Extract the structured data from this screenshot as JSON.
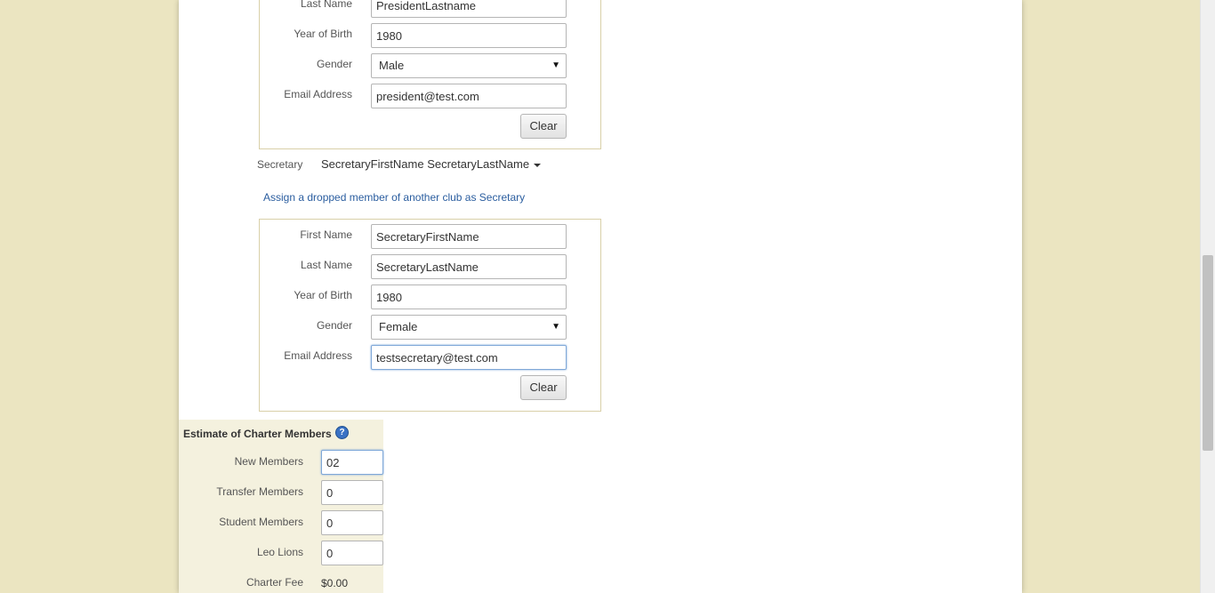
{
  "president": {
    "last_name_label": "Last Name",
    "last_name_value": "PresidentLastname",
    "yob_label": "Year of Birth",
    "yob_value": "1980",
    "gender_label": "Gender",
    "gender_value": "Male",
    "email_label": "Email Address",
    "email_value": "president@test.com",
    "clear_label": "Clear"
  },
  "secretary": {
    "role_label": "Secretary",
    "selected_name": "SecretaryFirstName SecretaryLastName",
    "assign_link": "Assign a dropped member of another club as Secretary",
    "first_name_label": "First Name",
    "first_name_value": "SecretaryFirstName",
    "last_name_label": "Last Name",
    "last_name_value": "SecretaryLastName",
    "yob_label": "Year of Birth",
    "yob_value": "1980",
    "gender_label": "Gender",
    "gender_value": "Female",
    "email_label": "Email Address",
    "email_value": "testsecretary@test.com",
    "clear_label": "Clear"
  },
  "estimate": {
    "title": "Estimate of Charter Members",
    "help_icon": "help-icon",
    "new_members_label": "New Members",
    "new_members_value": "02",
    "transfer_members_label": "Transfer Members",
    "transfer_members_value": "0",
    "student_members_label": "Student Members",
    "student_members_value": "0",
    "leo_lions_label": "Leo Lions",
    "leo_lions_value": "0",
    "charter_fee_label": "Charter Fee",
    "charter_fee_value": "$0.00"
  },
  "colors": {
    "background": "#ebe5c1",
    "link": "#2a5d9f",
    "estimate_panel": "#f4f1de"
  }
}
